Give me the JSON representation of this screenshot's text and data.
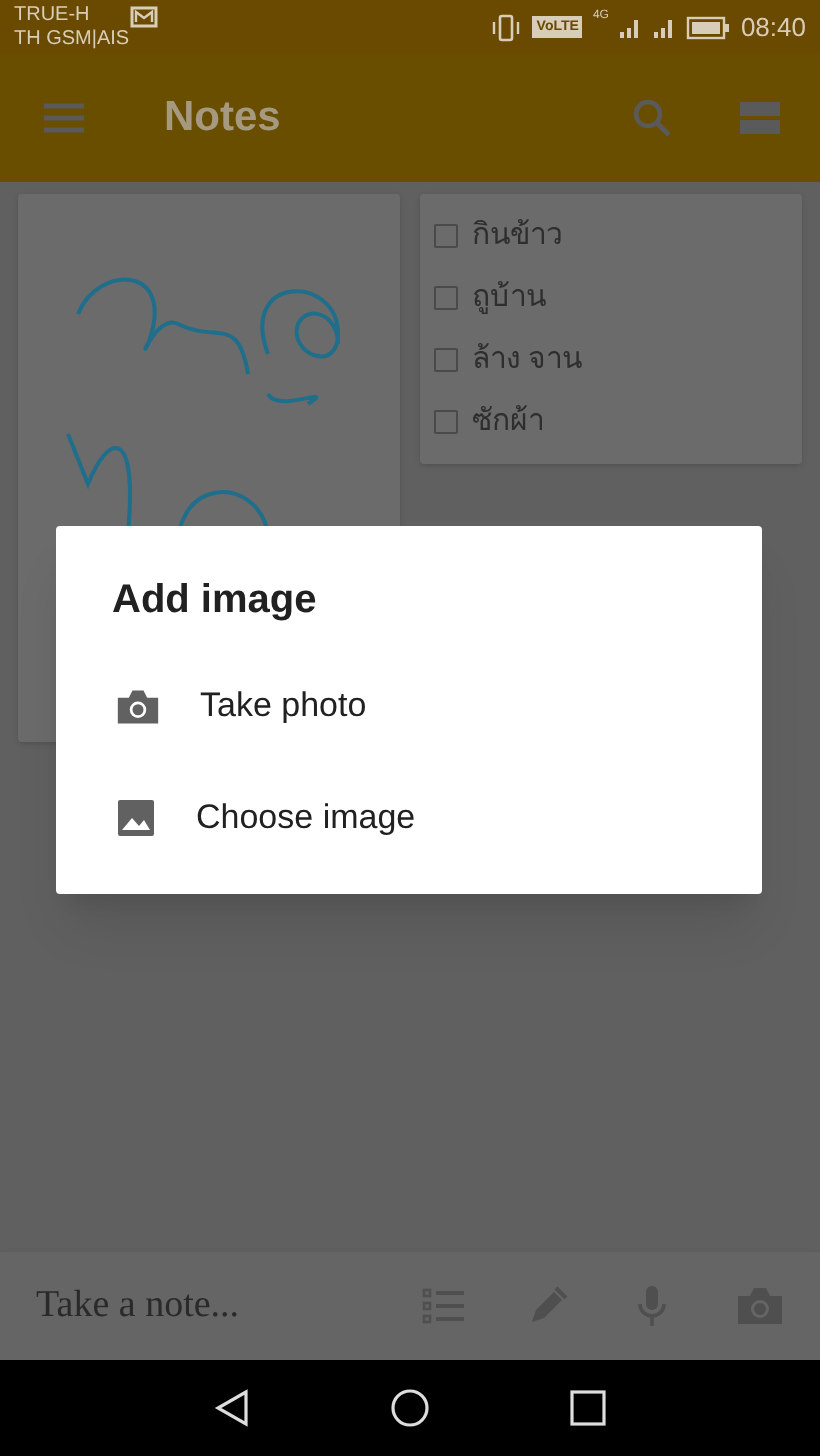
{
  "status_bar": {
    "carrier_1": "TRUE-H",
    "carrier_2": "TH GSM|AIS",
    "volte": "VoLTE",
    "network": "4G",
    "time": "08:40"
  },
  "app_bar": {
    "title": "Notes"
  },
  "notes": [
    {
      "kind": "drawing"
    },
    {
      "kind": "checklist",
      "items": [
        {
          "text": "กินข้าว",
          "checked": false
        },
        {
          "text": "ถูบ้าน",
          "checked": false
        },
        {
          "text": "ล้าง จาน",
          "checked": false
        },
        {
          "text": "ซักผ้า",
          "checked": false
        }
      ]
    }
  ],
  "dialog": {
    "title": "Add image",
    "options": [
      {
        "kind": "camera",
        "label": "Take photo"
      },
      {
        "kind": "image",
        "label": "Choose image"
      }
    ]
  },
  "bottom_bar": {
    "placeholder": "Take a note..."
  }
}
